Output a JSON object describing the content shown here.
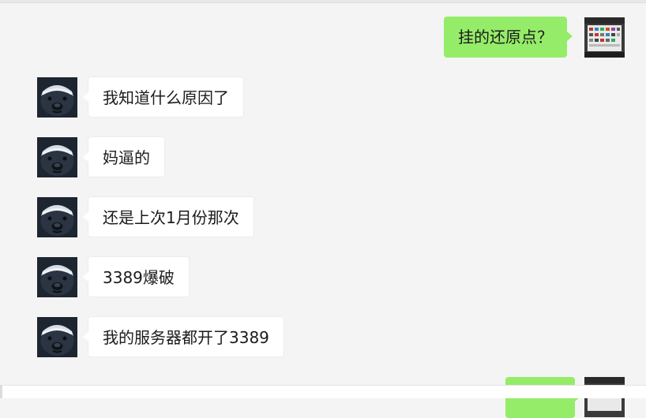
{
  "colors": {
    "background": "#f4f4f4",
    "incoming_bubble": "#ffffff",
    "outgoing_bubble": "#95ec69"
  },
  "avatars": {
    "self": "screenshot-thumbnail-avatar",
    "peer": "honey-badger-avatar"
  },
  "messages": [
    {
      "sender": "self",
      "text": "挂的还原点？"
    },
    {
      "sender": "peer",
      "text": "我知道什么原因了"
    },
    {
      "sender": "peer",
      "text": "妈逼的"
    },
    {
      "sender": "peer",
      "text": "还是上次1月份那次"
    },
    {
      "sender": "peer",
      "text": "3389爆破"
    },
    {
      "sender": "peer",
      "text": "我的服务器都开了3389"
    },
    {
      "sender": "self",
      "text": ""
    }
  ]
}
